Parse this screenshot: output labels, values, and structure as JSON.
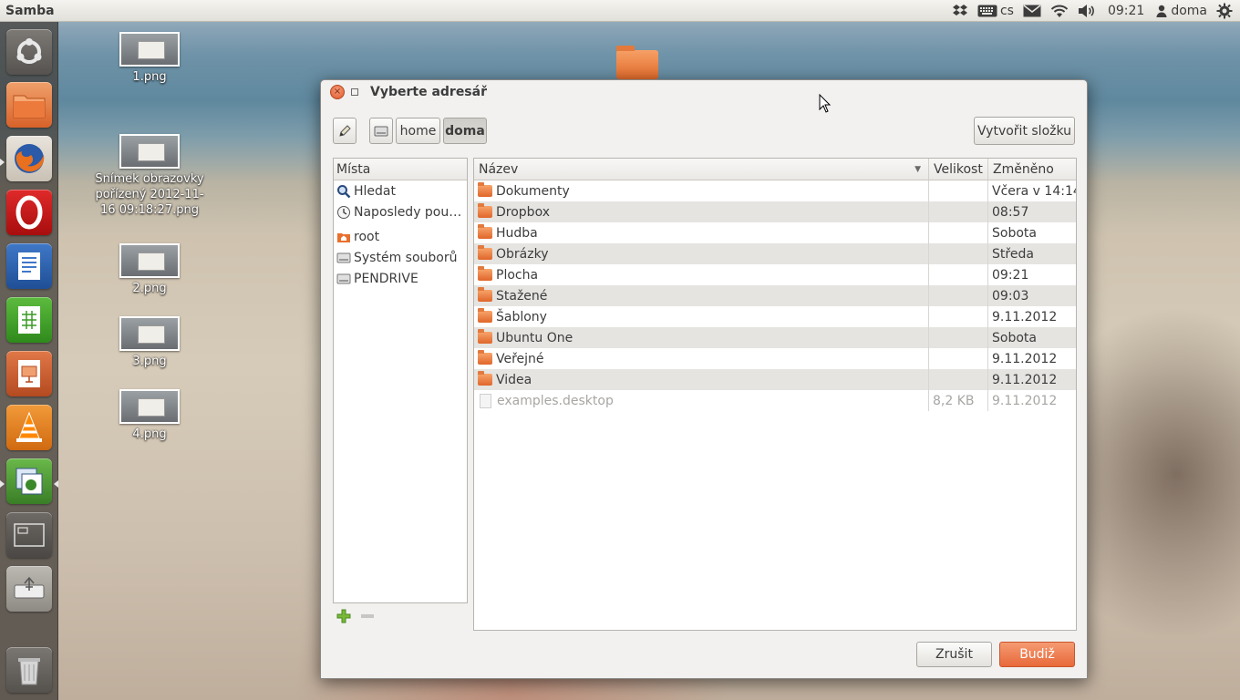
{
  "top_panel": {
    "app_title": "Samba",
    "keyboard_layout": "cs",
    "clock": "09:21",
    "user": "doma"
  },
  "launcher": {
    "items": [
      "ubuntu-logo",
      "files",
      "firefox",
      "opera",
      "writer",
      "calc",
      "impress",
      "vlc",
      "system-tool",
      "workspaces",
      "usb-drive",
      "trash"
    ]
  },
  "desktop": {
    "icons": [
      {
        "label": "1.png"
      },
      {
        "label": "Snímek obrazovky pořízený 2012-11-16 09:18:27.png"
      },
      {
        "label": "2.png"
      },
      {
        "label": "3.png"
      },
      {
        "label": "4.png"
      }
    ]
  },
  "dialog": {
    "title": "Vyberte adresář",
    "path": [
      "home",
      "doma"
    ],
    "create_folder_label": "Vytvořit složku",
    "places_header": "Místa",
    "places": [
      {
        "label": "Hledat",
        "icon": "search-icon"
      },
      {
        "label": "Naposledy pou…",
        "icon": "recent-icon"
      },
      {
        "label": "root",
        "icon": "home-folder-icon"
      },
      {
        "label": "Systém souborů",
        "icon": "drive-icon"
      },
      {
        "label": "PENDRIVE",
        "icon": "drive-icon"
      }
    ],
    "columns": {
      "name": "Název",
      "size": "Velikost",
      "modified": "Změněno"
    },
    "files": [
      {
        "name": "Dokumenty",
        "size": "",
        "modified": "Včera v 14:14",
        "type": "folder"
      },
      {
        "name": "Dropbox",
        "size": "",
        "modified": "08:57",
        "type": "folder"
      },
      {
        "name": "Hudba",
        "size": "",
        "modified": "Sobota",
        "type": "folder"
      },
      {
        "name": "Obrázky",
        "size": "",
        "modified": "Středa",
        "type": "folder"
      },
      {
        "name": "Plocha",
        "size": "",
        "modified": "09:21",
        "type": "folder"
      },
      {
        "name": "Stažené",
        "size": "",
        "modified": "09:03",
        "type": "folder"
      },
      {
        "name": "Šablony",
        "size": "",
        "modified": "9.11.2012",
        "type": "folder"
      },
      {
        "name": "Ubuntu One",
        "size": "",
        "modified": "Sobota",
        "type": "folder"
      },
      {
        "name": "Veřejné",
        "size": "",
        "modified": "9.11.2012",
        "type": "folder"
      },
      {
        "name": "Videa",
        "size": "",
        "modified": "9.11.2012",
        "type": "folder"
      },
      {
        "name": "examples.desktop",
        "size": "8,2 KB",
        "modified": "9.11.2012",
        "type": "file"
      }
    ],
    "cancel_label": "Zrušit",
    "ok_label": "Budiž"
  }
}
